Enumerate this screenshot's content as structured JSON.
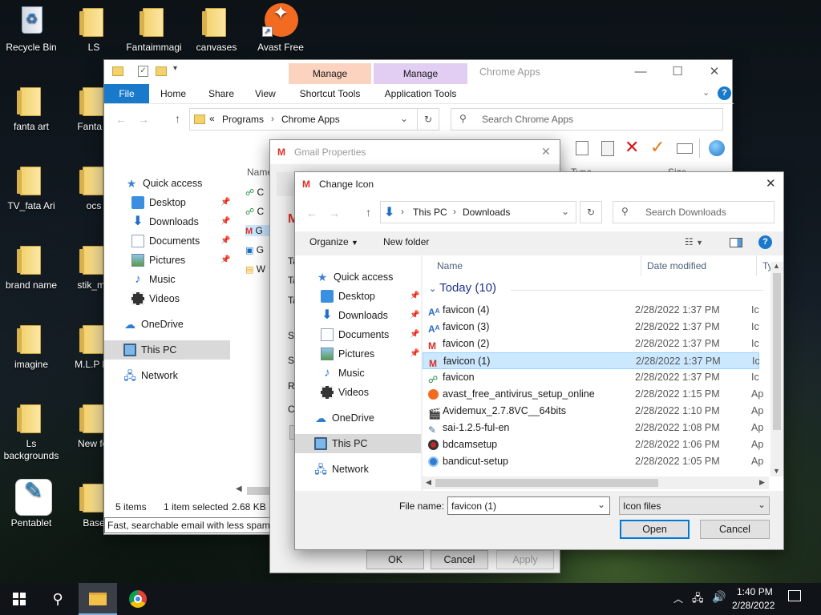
{
  "desktop": {
    "icons": [
      {
        "label": "Recycle Bin",
        "kind": "bin"
      },
      {
        "label": "LS",
        "kind": "folder"
      },
      {
        "label": "Fantaimmagi",
        "kind": "folder"
      },
      {
        "label": "canvases",
        "kind": "folder"
      },
      {
        "label": "Avast Free",
        "kind": "avast"
      },
      {
        "label": "fanta art",
        "kind": "folder"
      },
      {
        "label": "Fanta A",
        "kind": "folder"
      },
      {
        "label": "TV_fata Ari",
        "kind": "folder"
      },
      {
        "label": "ocs",
        "kind": "folder"
      },
      {
        "label": "brand name",
        "kind": "folder"
      },
      {
        "label": "stik_mo",
        "kind": "folder"
      },
      {
        "label": "imagine",
        "kind": "folder"
      },
      {
        "label": "M.L.P ba",
        "kind": "folder"
      },
      {
        "label": "Ls backgrounds",
        "kind": "folder"
      },
      {
        "label": "New fol",
        "kind": "folder"
      },
      {
        "label": "Pentablet",
        "kind": "pentablet"
      },
      {
        "label": "Base",
        "kind": "folder"
      }
    ]
  },
  "explorer": {
    "title": "Chrome Apps",
    "ribbon_tabs": [
      "File",
      "Home",
      "Share",
      "View"
    ],
    "manage_tabs": [
      {
        "group": "Manage",
        "label": "Shortcut Tools",
        "color": "#fcd3bf"
      },
      {
        "group": "Manage",
        "label": "Application Tools",
        "color": "#e2cdf3"
      }
    ],
    "path": {
      "sep": "«",
      "part1": "Programs",
      "part2": "Chrome Apps"
    },
    "search_placeholder": "Search Chrome Apps",
    "nav": {
      "quick_access": "Quick access",
      "desktop": "Desktop",
      "downloads": "Downloads",
      "documents": "Documents",
      "pictures": "Pictures",
      "music": "Music",
      "videos": "Videos",
      "onedrive": "OneDrive",
      "this_pc": "This PC",
      "network": "Network"
    },
    "column_name": "Name",
    "column_type": "Type",
    "column_size": "Size",
    "file_stubs": [
      "C",
      "C",
      "G",
      "G",
      "W"
    ],
    "status_items": "5 items",
    "status_selected": "1 item selected",
    "status_size": "2.68 KB",
    "tooltip": "Fast, searchable email with less spam."
  },
  "gmail_props": {
    "title": "Gmail Properties",
    "stub_labels": [
      "Ta",
      "Ta",
      "Ta",
      "St",
      "Sh",
      "Ru",
      "Co"
    ],
    "ok": "OK",
    "cancel": "Cancel",
    "apply": "Apply"
  },
  "change_icon": {
    "title": "Change Icon",
    "path_this_pc": "This PC",
    "path_downloads": "Downloads",
    "search_placeholder": "Search Downloads",
    "organize": "Organize",
    "new_folder": "New folder",
    "col_name": "Name",
    "col_date": "Date modified",
    "col_type": "Ty",
    "group": "Today (10)",
    "files": [
      {
        "name": "favicon (4)",
        "date": "2/28/2022 1:37 PM",
        "type": "Ic",
        "icon": "chat"
      },
      {
        "name": "favicon (3)",
        "date": "2/28/2022 1:37 PM",
        "type": "Ic",
        "icon": "chat"
      },
      {
        "name": "favicon (2)",
        "date": "2/28/2022 1:37 PM",
        "type": "Ic",
        "icon": "gmail"
      },
      {
        "name": "favicon (1)",
        "date": "2/28/2022 1:37 PM",
        "type": "Ic",
        "icon": "gmail",
        "selected": true
      },
      {
        "name": "favicon",
        "date": "2/28/2022 1:37 PM",
        "type": "Ic",
        "icon": "wa"
      },
      {
        "name": "avast_free_antivirus_setup_online",
        "date": "2/28/2022 1:15 PM",
        "type": "Ap",
        "icon": "avast"
      },
      {
        "name": "Avidemux_2.7.8VC__64bits",
        "date": "2/28/2022 1:10 PM",
        "type": "Ap",
        "icon": "clap"
      },
      {
        "name": "sai-1.2.5-ful-en",
        "date": "2/28/2022 1:08 PM",
        "type": "Ap",
        "icon": "sai"
      },
      {
        "name": "bdcamsetup",
        "date": "2/28/2022 1:06 PM",
        "type": "Ap",
        "icon": "bdcam"
      },
      {
        "name": "bandicut-setup",
        "date": "2/28/2022 1:05 PM",
        "type": "Ap",
        "icon": "band"
      }
    ],
    "file_name_label": "File name:",
    "file_name_value": "favicon (1)",
    "file_type": "Icon files",
    "open": "Open",
    "cancel": "Cancel"
  },
  "taskbar": {
    "time": "1:40 PM",
    "date": "2/28/2022"
  },
  "colors": {
    "accent": "#0078d7",
    "selected_row": "#cce8ff",
    "file_tab": "#1979ca"
  }
}
